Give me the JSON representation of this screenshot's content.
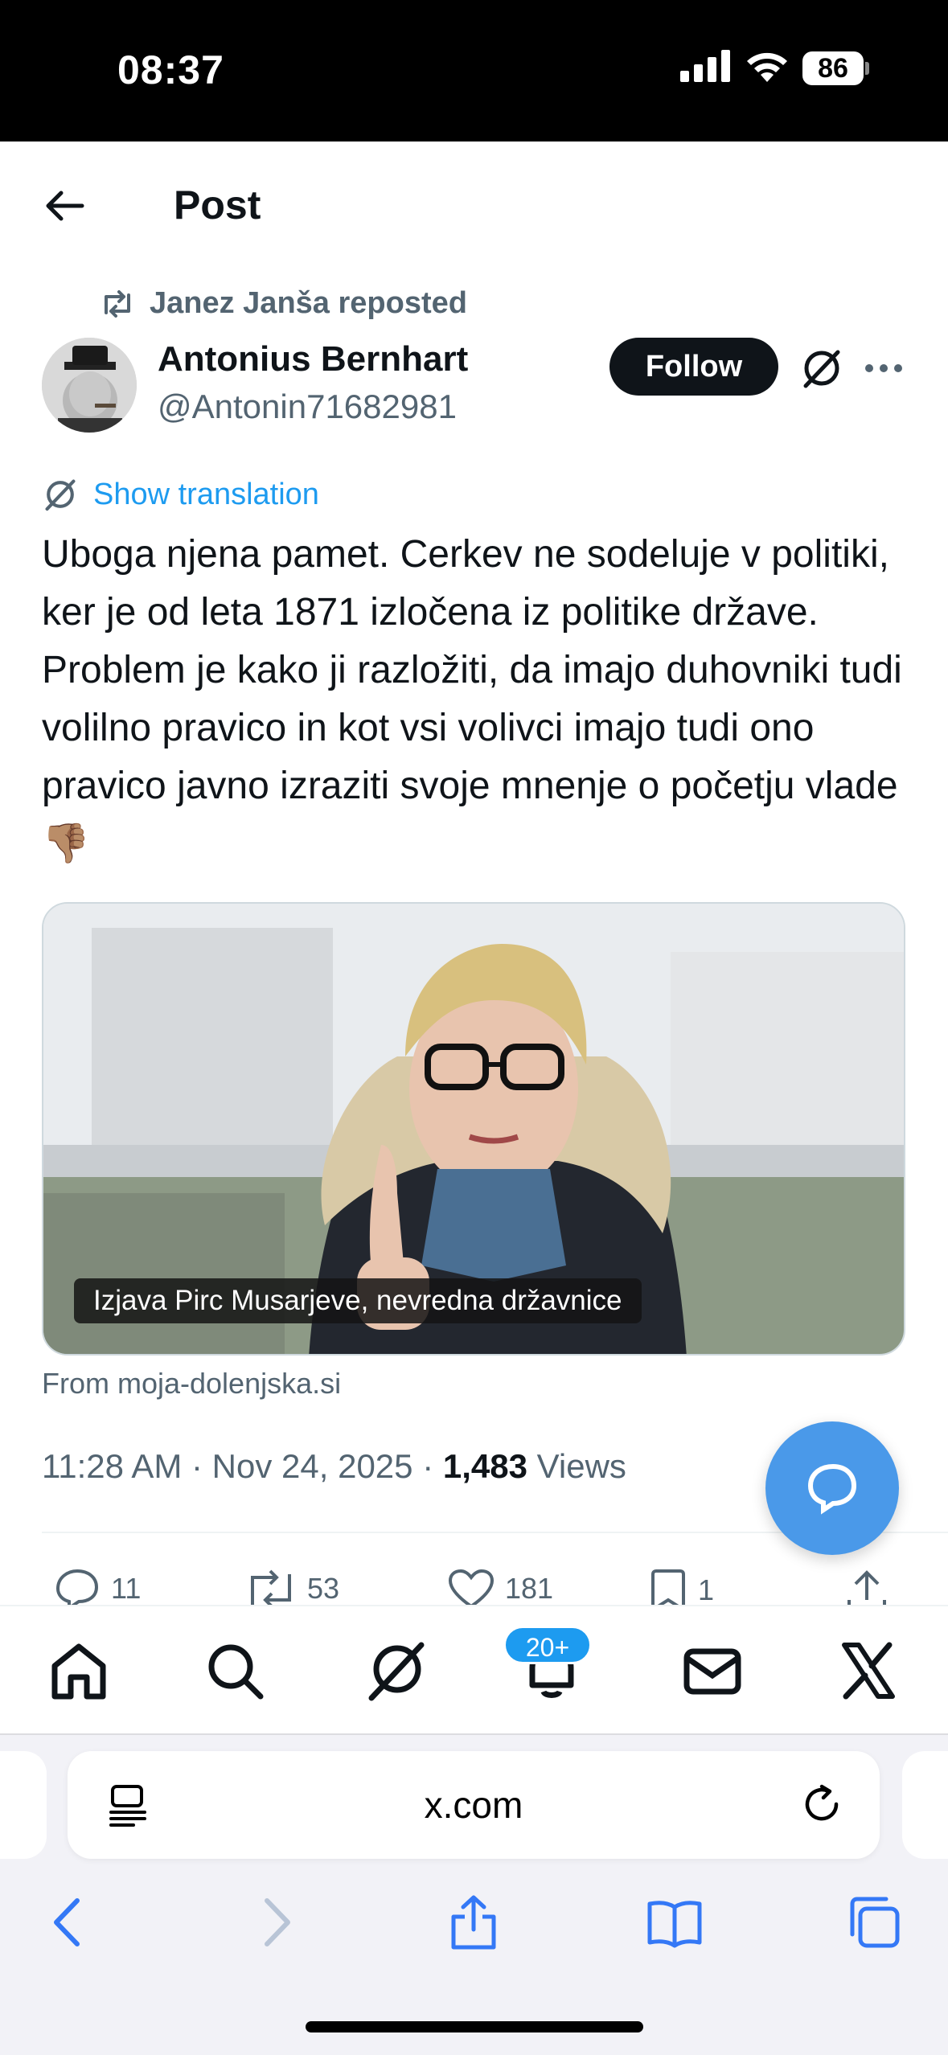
{
  "status_bar": {
    "time": "08:37",
    "battery": "86"
  },
  "header": {
    "title": "Post"
  },
  "repost": {
    "label": "Janez Janša reposted"
  },
  "author": {
    "name": "Antonius Bernhart",
    "handle": "@Antonin71682981"
  },
  "follow_label": "Follow",
  "translate_label": "Show translation",
  "tweet_text": "Uboga njena pamet. Cerkev ne sodeluje v politiki, ker je od leta 1871 izločena iz politike države. Problem je kako ji razložiti, da imajo duhovniki tudi volilno pravico in kot vsi volivci imajo tudi ono pravico javno izraziti svoje mnenje o početju vlade👎🏽",
  "media": {
    "caption": "Izjava Pirc Musarjeve, nevredna državnice",
    "source": "From moja-dolenjska.si"
  },
  "meta": {
    "time": "11:28 AM",
    "date": "Nov 24, 2025",
    "views_count": "1,483",
    "views_label": "Views"
  },
  "actions": {
    "replies": "11",
    "reposts": "53",
    "likes": "181",
    "bookmarks": "1"
  },
  "tabbar": {
    "notifications_badge": "20+"
  },
  "safari": {
    "url": "x.com"
  },
  "icons": [
    "back-arrow-icon",
    "repost-icon",
    "grok-icon",
    "more-icon",
    "reply-icon",
    "like-icon",
    "bookmark-icon",
    "share-icon",
    "home-icon",
    "search-icon",
    "bell-icon",
    "mail-icon",
    "x-logo-icon",
    "reader-icon",
    "reload-icon",
    "tabs-icon"
  ]
}
